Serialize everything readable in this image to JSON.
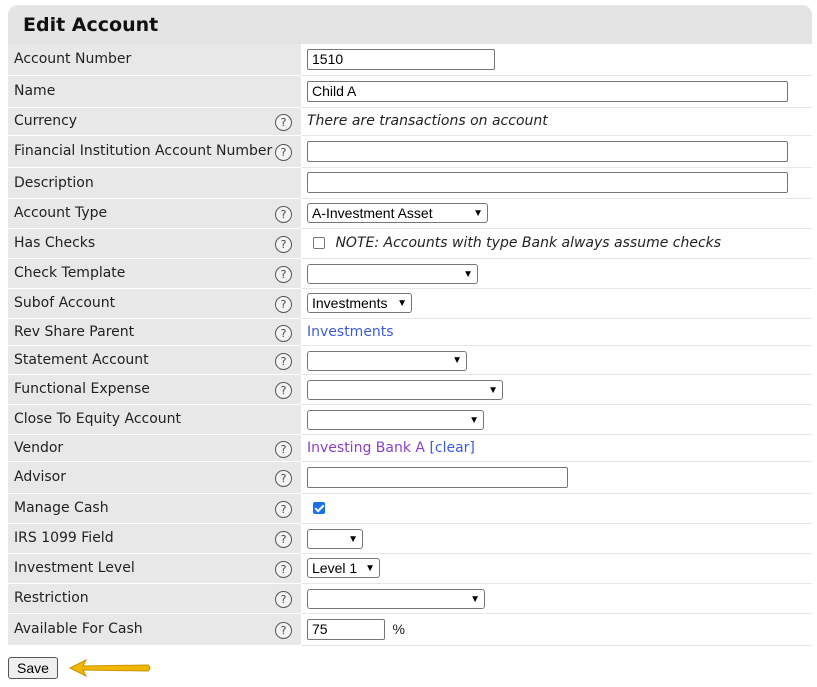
{
  "title": "Edit Account",
  "help_glyph": "?",
  "fields": {
    "account_number": {
      "label": "Account Number",
      "value": "1510"
    },
    "name": {
      "label": "Name",
      "value": "Child A"
    },
    "currency": {
      "label": "Currency",
      "note": "There are transactions on account"
    },
    "fin_inst_account_number": {
      "label": "Financial Institution Account Number",
      "value": ""
    },
    "description": {
      "label": "Description",
      "value": ""
    },
    "account_type": {
      "label": "Account Type",
      "value": "A-Investment Asset"
    },
    "has_checks": {
      "label": "Has Checks",
      "checked": false,
      "note": "NOTE: Accounts with type Bank always assume checks"
    },
    "check_template": {
      "label": "Check Template",
      "value": ""
    },
    "subof_account": {
      "label": "Subof Account",
      "value": "Investments"
    },
    "rev_share_parent": {
      "label": "Rev Share Parent",
      "value": "Investments"
    },
    "statement_account": {
      "label": "Statement Account",
      "value": ""
    },
    "functional_expense": {
      "label": "Functional Expense",
      "value": ""
    },
    "close_to_equity": {
      "label": "Close To Equity Account",
      "value": ""
    },
    "vendor": {
      "label": "Vendor",
      "value": "Investing Bank A",
      "clear_label": "[clear]"
    },
    "advisor": {
      "label": "Advisor",
      "value": ""
    },
    "manage_cash": {
      "label": "Manage Cash",
      "checked": true
    },
    "irs_1099": {
      "label": "IRS 1099 Field",
      "value": ""
    },
    "investment_level": {
      "label": "Investment Level",
      "value": "Level 1"
    },
    "restriction": {
      "label": "Restriction",
      "value": ""
    },
    "available_for_cash": {
      "label": "Available For Cash",
      "value": "75",
      "unit": "%"
    }
  },
  "save_label": "Save",
  "colors": {
    "arrow": "#f2b705",
    "link_blue": "#3b5bdb",
    "link_purple": "#8a3fc9",
    "label_bg": "#e8e8e8"
  }
}
